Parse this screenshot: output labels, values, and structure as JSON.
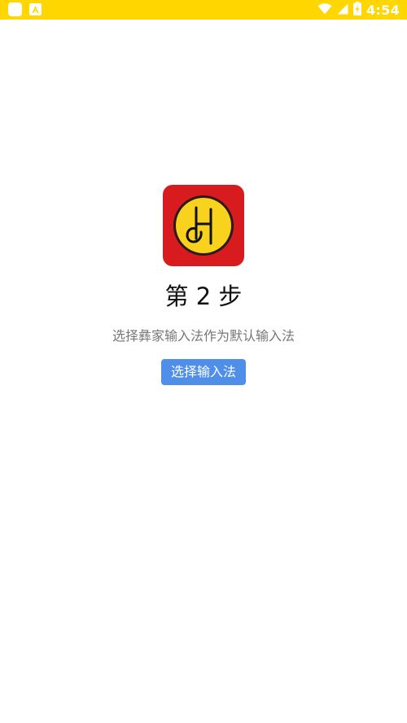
{
  "status_bar": {
    "time": "4:54",
    "icons": [
      "app-notification-icon",
      "a-notification-icon",
      "wifi-icon",
      "cell-signal-icon",
      "battery-charging-icon"
    ],
    "background_color": "#FFD600"
  },
  "main": {
    "logo": {
      "icon": "app-logo-icon",
      "background_color": "#D81B1F",
      "circle_color": "#F9D21D"
    },
    "step_title": "第 2 步",
    "subtitle": "选择彝家输入法作为默认输入法",
    "select_button_label": "选择输入法",
    "button_color": "#4F8FEA"
  }
}
